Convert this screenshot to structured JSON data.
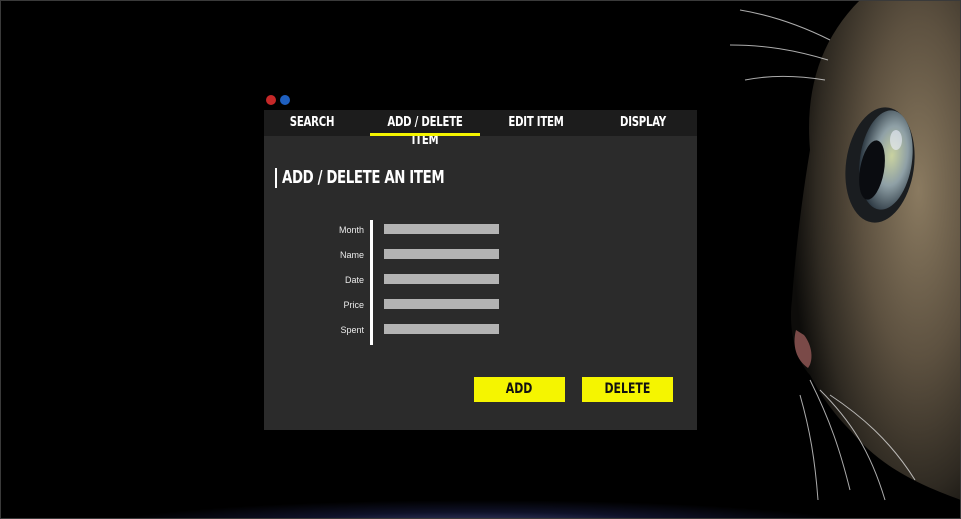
{
  "window_controls": [
    {
      "name": "close",
      "color": "#c62828"
    },
    {
      "name": "minimize",
      "color": "#1e5fbf"
    }
  ],
  "nav": {
    "tabs": [
      {
        "label": "SEARCH",
        "active": false
      },
      {
        "label": "ADD / DELETE ITEM",
        "active": true
      },
      {
        "label": "EDIT ITEM",
        "active": false
      },
      {
        "label": "DISPLAY",
        "active": false
      }
    ],
    "active_color": "#f5f500"
  },
  "page": {
    "title": "ADD / DELETE AN ITEM"
  },
  "form": {
    "fields": [
      {
        "label": "Month",
        "value": ""
      },
      {
        "label": "Name",
        "value": ""
      },
      {
        "label": "Date",
        "value": ""
      },
      {
        "label": "Price",
        "value": ""
      },
      {
        "label": "Spent",
        "value": ""
      }
    ]
  },
  "actions": {
    "add_label": "ADD",
    "delete_label": "DELETE",
    "button_color": "#f5f500"
  },
  "background": {
    "description_icon": "cat-face-wallpaper"
  }
}
